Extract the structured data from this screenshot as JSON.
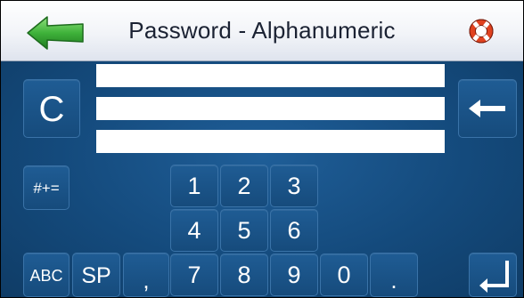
{
  "header": {
    "title": "Password - Alphanumeric",
    "back_icon": "green-left-arrow-icon",
    "help_icon": "lifebuoy-icon"
  },
  "colors": {
    "background": "#144a7c",
    "key": "#1a5488",
    "key_border": "#3a73a8",
    "field": "#ffffff",
    "back_arrow": "#3fb23a",
    "help_red": "#e0421f"
  },
  "keys": {
    "clear": "C",
    "symbols": "#+=",
    "abc": "ABC",
    "space": "SP",
    "comma": ",",
    "dot": ".",
    "backspace_icon": "backspace-arrow-icon",
    "enter_icon": "enter-return-icon",
    "numbers": [
      "1",
      "2",
      "3",
      "4",
      "5",
      "6",
      "7",
      "8",
      "9",
      "0"
    ]
  },
  "fields": [
    "",
    "",
    ""
  ]
}
